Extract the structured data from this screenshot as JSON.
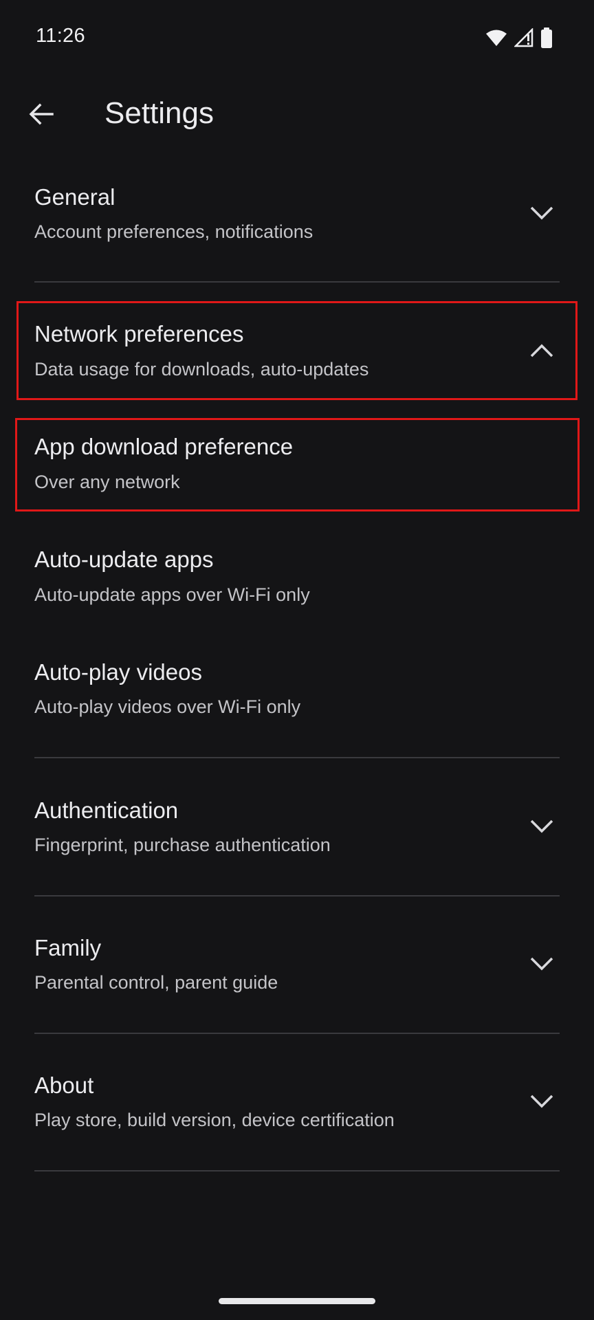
{
  "status_bar": {
    "time": "11:26",
    "icons": [
      "wifi-icon",
      "cell-signal-icon",
      "battery-icon"
    ]
  },
  "app_bar": {
    "back_icon": "arrow-back-icon",
    "title": "Settings"
  },
  "sections": {
    "general": {
      "title": "General",
      "subtitle": "Account preferences, notifications",
      "state": "collapsed"
    },
    "network": {
      "title": "Network preferences",
      "subtitle": "Data usage for downloads, auto-updates",
      "state": "expanded"
    },
    "network_items": {
      "app_download": {
        "title": "App download preference",
        "subtitle": "Over any network"
      },
      "auto_update": {
        "title": "Auto-update apps",
        "subtitle": "Auto-update apps over Wi-Fi only"
      },
      "auto_play": {
        "title": "Auto-play videos",
        "subtitle": "Auto-play videos over Wi-Fi only"
      }
    },
    "authentication": {
      "title": "Authentication",
      "subtitle": "Fingerprint, purchase authentication",
      "state": "collapsed"
    },
    "family": {
      "title": "Family",
      "subtitle": "Parental control, parent guide",
      "state": "collapsed"
    },
    "about": {
      "title": "About",
      "subtitle": "Play store, build version, device certification",
      "state": "collapsed"
    }
  },
  "colors": {
    "background": "#141416",
    "highlight": "#e01818",
    "divider": "#3a3a3e"
  }
}
